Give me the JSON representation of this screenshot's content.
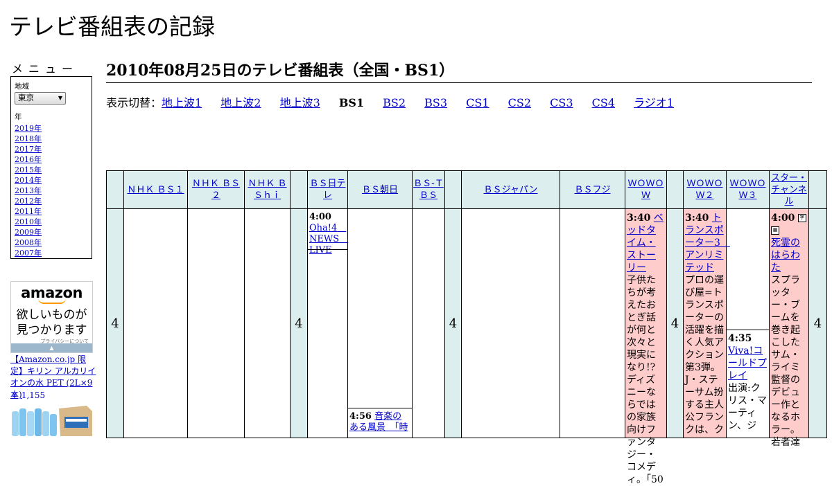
{
  "site": {
    "title": "テレビ番組表の記録"
  },
  "menu": {
    "heading": "メニュー",
    "region_label": "地域",
    "region_selected": "東京",
    "year_label": "年",
    "years": [
      "2019年",
      "2018年",
      "2017年",
      "2016年",
      "2015年",
      "2014年",
      "2013年",
      "2012年",
      "2011年",
      "2010年",
      "2009年",
      "2008年",
      "2007年"
    ]
  },
  "ad": {
    "brand": "amazon",
    "copy_line1": "欲しいものが",
    "copy_line2": "見つかります",
    "privacy": "プライバシーについて",
    "product_title": "【Amazon.co.jp 限定】キリン アルカリイオンの水 PET (2L×9本)",
    "product_price": "￥ 1,155"
  },
  "main": {
    "title": "2010年08月25日のテレビ番組表（全国・BS1）",
    "switch_label": "表示切替：",
    "switch_items": [
      {
        "label": "地上波1",
        "current": false
      },
      {
        "label": "地上波2",
        "current": false
      },
      {
        "label": "地上波3",
        "current": false
      },
      {
        "label": "BS1",
        "current": true
      },
      {
        "label": "BS2",
        "current": false
      },
      {
        "label": "BS3",
        "current": false
      },
      {
        "label": "CS1",
        "current": false
      },
      {
        "label": "CS2",
        "current": false
      },
      {
        "label": "CS3",
        "current": false
      },
      {
        "label": "CS4",
        "current": false
      },
      {
        "label": "ラジオ1",
        "current": false
      }
    ]
  },
  "schedule": {
    "hour": "4",
    "channels": {
      "nhkbs1": "ＮＨＫ ＢＳ１",
      "nhkbs2": "ＮＨＫ ＢＳ２",
      "nhkbshi": "ＮＨＫ ＢＳｈｉ",
      "bsntv": "ＢＳ日テレ",
      "bsasahi": "ＢＳ朝日",
      "bstbs": "ＢＳ-ＴＢＳ",
      "bsjapan": "ＢＳジャパン",
      "bsfuji": "ＢＳフジ",
      "wowow": "ＷＯＷＯＷ",
      "wowow2": "ＷＯＷＯＷ２",
      "wowow3": "ＷＯＷＯＷ３",
      "star": "スター・チャンネル"
    },
    "programs": {
      "bsntv_1": {
        "time": "4:00",
        "title": "Oha!4　NEWS　LIVE"
      },
      "bsasahi_1": {
        "time": "4:56",
        "title": "音楽のある風景　「時"
      },
      "wowow_1": {
        "time": "3:40",
        "title": "ベッドタイム・ストーリー",
        "desc": "子供たちが考えたおとぎ話が何と次々と現実になり!?　ディズニーならではの家族向けファンタジー・コメディ。「50"
      },
      "wowow2_1": {
        "time": "3:40",
        "title": "トランスポーター3　アンリミテッド",
        "desc": "プロの運び屋=トランスポーターの活躍を描く人気アクション第3弾。J・ステーサム扮する主人公フランクは、ク"
      },
      "wowow3_1": {
        "time": "4:35",
        "title": "Viva!コールドプレイ",
        "desc": "出演:クリス・マーティン、ジ"
      },
      "star_1": {
        "time": "4:00",
        "title": "死霊のはらわた",
        "desc": "スプラッター・ブームを巻き起こしたサム・ライミ監督のデビュー作となるホラー。若者達"
      }
    }
  }
}
